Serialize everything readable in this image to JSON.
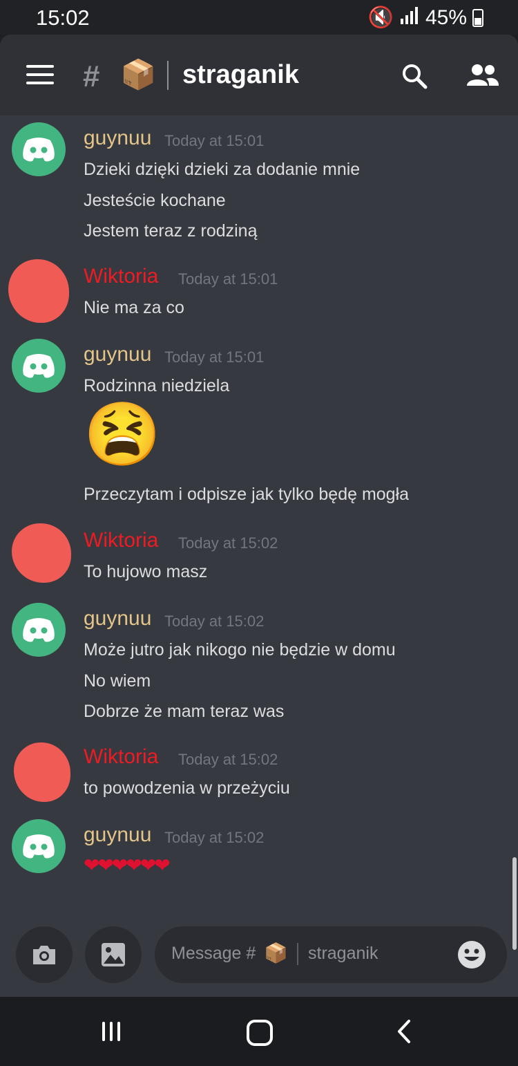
{
  "status_bar": {
    "time": "15:02",
    "battery": "45%"
  },
  "header": {
    "channel_hash": "#",
    "channel_emoji": "📦",
    "channel_name": "straganik"
  },
  "messages": [
    {
      "author": "guynuu",
      "timestamp": "Today at 15:01",
      "author_color": "#e3c58a",
      "lines": [
        "Dzieki dzięki dzieki za dodanie mnie",
        "Jesteście kochane",
        "Jestem teraz z rodziną"
      ]
    },
    {
      "author": "Wiktoria",
      "timestamp": "Today at 15:01",
      "author_color": "#ed1c24",
      "lines": [
        "Nie ma za co"
      ]
    },
    {
      "author": "guynuu",
      "timestamp": "Today at 15:01",
      "author_color": "#e3c58a",
      "lines": [
        "Rodzinna niedziela",
        "😫",
        "Przeczytam i odpisze jak tylko będę mogła"
      ]
    },
    {
      "author": "Wiktoria",
      "timestamp": "Today at 15:02",
      "author_color": "#ed1c24",
      "lines": [
        "To hujowo masz"
      ]
    },
    {
      "author": "guynuu",
      "timestamp": "Today at 15:02",
      "author_color": "#e3c58a",
      "lines": [
        "Może jutro jak nikogo nie będzie w domu",
        "No wiem",
        "Dobrze że mam teraz was"
      ]
    },
    {
      "author": "Wiktoria",
      "timestamp": "Today at 15:02",
      "author_color": "#ed1c24",
      "lines": [
        "to powodzenia w przeżyciu"
      ]
    },
    {
      "author": "guynuu",
      "timestamp": "Today at 15:02",
      "author_color": "#e3c58a",
      "lines": [
        "❤❤❤❤❤❤"
      ]
    }
  ],
  "composer": {
    "placeholder_prefix": "Message #",
    "placeholder_emoji": "📦",
    "placeholder_channel": "straganik"
  },
  "icons": {
    "menu": "hamburger-icon",
    "search": "search-icon",
    "members": "members-icon",
    "camera": "camera-icon",
    "gallery": "image-icon",
    "emoji": "smiley-icon"
  },
  "colors": {
    "background": "#36393f",
    "header": "#2f3136",
    "discord_green": "#43b581"
  }
}
